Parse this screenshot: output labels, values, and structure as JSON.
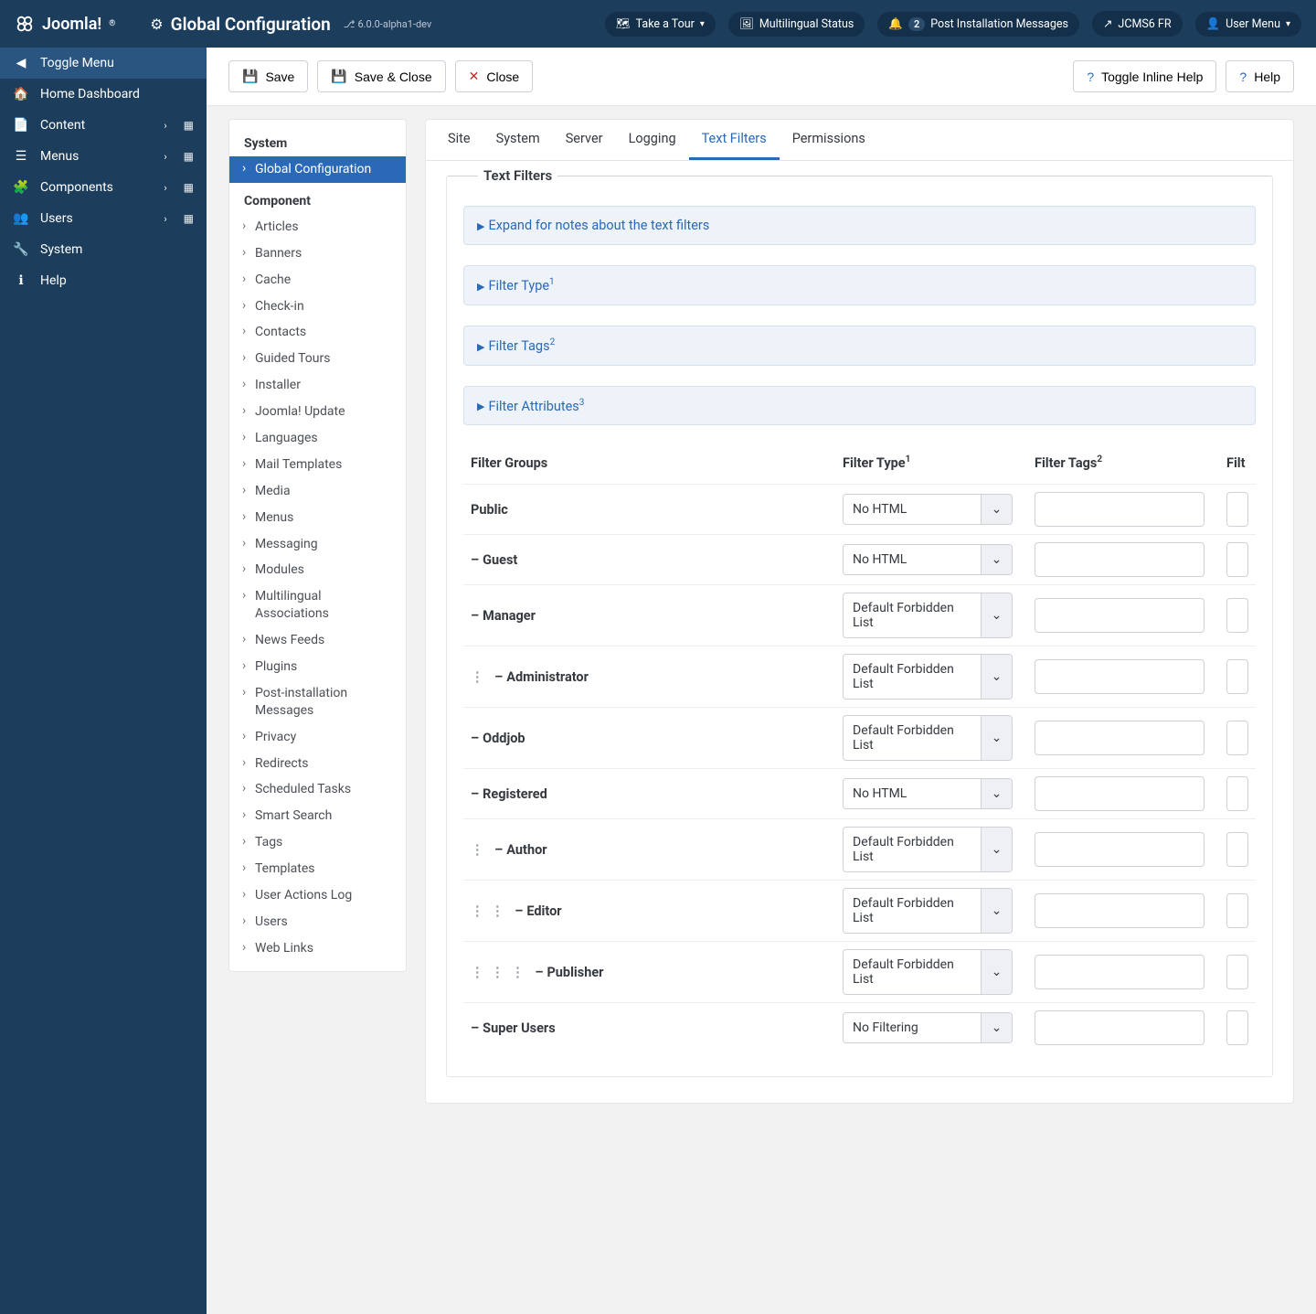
{
  "header": {
    "brand": "Joomla!",
    "title": "Global Configuration",
    "version": "6.0.0-alpha1-dev",
    "pills": {
      "tour": "Take a Tour",
      "multilingual": "Multilingual Status",
      "post_count": "2",
      "post_label": "Post Installation Messages",
      "site_link": "JCMS6 FR",
      "user_menu": "User Menu"
    }
  },
  "sidebar": {
    "toggle": "Toggle Menu",
    "items": [
      {
        "icon": "home",
        "label": "Home Dashboard"
      },
      {
        "icon": "file",
        "label": "Content",
        "sub": true
      },
      {
        "icon": "list",
        "label": "Menus",
        "sub": true
      },
      {
        "icon": "puzzle",
        "label": "Components",
        "sub": true
      },
      {
        "icon": "users",
        "label": "Users",
        "sub": true
      },
      {
        "icon": "wrench",
        "label": "System"
      },
      {
        "icon": "info",
        "label": "Help"
      }
    ]
  },
  "toolbar": {
    "save": "Save",
    "save_close": "Save & Close",
    "close": "Close",
    "toggle_help": "Toggle Inline Help",
    "help": "Help"
  },
  "subnav": {
    "heading_system": "System",
    "global_config": "Global Configuration",
    "heading_component": "Component",
    "components": [
      "Articles",
      "Banners",
      "Cache",
      "Check-in",
      "Contacts",
      "Guided Tours",
      "Installer",
      "Joomla! Update",
      "Languages",
      "Mail Templates",
      "Media",
      "Menus",
      "Messaging",
      "Modules",
      "Multilingual Associations",
      "News Feeds",
      "Plugins",
      "Post-installation Messages",
      "Privacy",
      "Redirects",
      "Scheduled Tasks",
      "Smart Search",
      "Tags",
      "Templates",
      "User Actions Log",
      "Users",
      "Web Links"
    ]
  },
  "tabs": [
    "Site",
    "System",
    "Server",
    "Logging",
    "Text Filters",
    "Permissions"
  ],
  "tabs_active_index": 4,
  "fieldset_legend": "Text Filters",
  "expanders": {
    "notes": "Expand for notes about the text filters",
    "filter_type": "Filter Type",
    "filter_tags": "Filter Tags",
    "filter_attrs": "Filter Attributes"
  },
  "table": {
    "headers": {
      "groups": "Filter Groups",
      "type": "Filter Type",
      "tags": "Filter Tags",
      "attrs": "Filter Attributes"
    },
    "rows": [
      {
        "indent": 0,
        "dash": false,
        "name": "Public",
        "type": "No HTML",
        "tags": "",
        "attrs": ""
      },
      {
        "indent": 0,
        "dash": true,
        "name": "Guest",
        "type": "No HTML",
        "tags": "",
        "attrs": ""
      },
      {
        "indent": 0,
        "dash": true,
        "name": "Manager",
        "type": "Default Forbidden List",
        "tags": "",
        "attrs": ""
      },
      {
        "indent": 1,
        "dash": true,
        "name": "Administrator",
        "type": "Default Forbidden List",
        "tags": "",
        "attrs": ""
      },
      {
        "indent": 0,
        "dash": true,
        "name": "Oddjob",
        "type": "Default Forbidden List",
        "tags": "",
        "attrs": ""
      },
      {
        "indent": 0,
        "dash": true,
        "name": "Registered",
        "type": "No HTML",
        "tags": "",
        "attrs": ""
      },
      {
        "indent": 1,
        "dash": true,
        "name": "Author",
        "type": "Default Forbidden List",
        "tags": "",
        "attrs": ""
      },
      {
        "indent": 2,
        "dash": true,
        "name": "Editor",
        "type": "Default Forbidden List",
        "tags": "",
        "attrs": ""
      },
      {
        "indent": 3,
        "dash": true,
        "name": "Publisher",
        "type": "Default Forbidden List",
        "tags": "",
        "attrs": ""
      },
      {
        "indent": 0,
        "dash": true,
        "name": "Super Users",
        "type": "No Filtering",
        "tags": "",
        "attrs": ""
      }
    ]
  }
}
